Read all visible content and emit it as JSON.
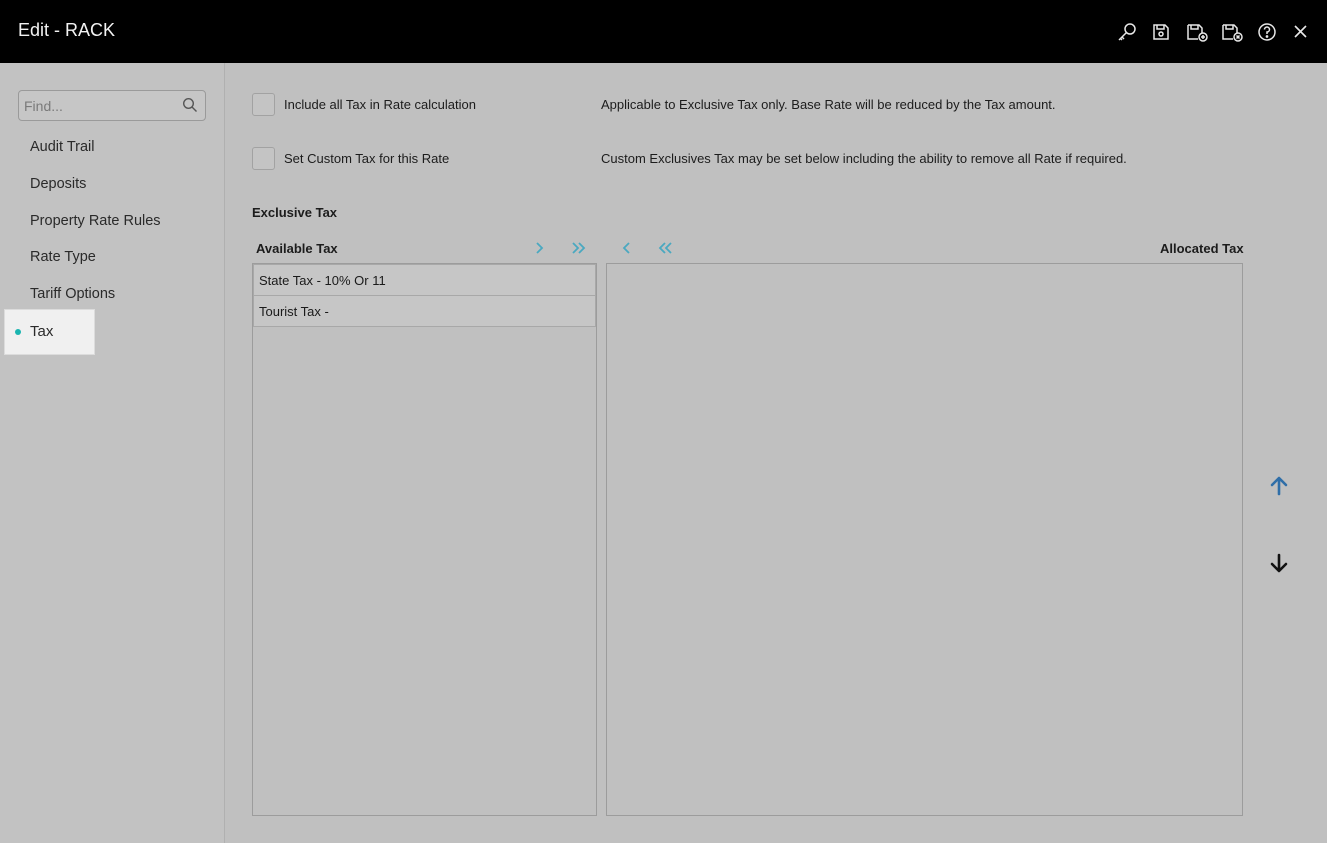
{
  "window": {
    "title": "Edit - RACK"
  },
  "toolbar": {
    "icons": [
      "key-icon",
      "save-icon",
      "save-new-icon",
      "save-close-icon",
      "help-icon",
      "close-icon"
    ]
  },
  "sidebar": {
    "search_placeholder": "Find...",
    "items": [
      {
        "label": "Audit Trail"
      },
      {
        "label": "Deposits"
      },
      {
        "label": "Property Rate Rules"
      },
      {
        "label": "Rate Type"
      },
      {
        "label": "Tariff Options"
      },
      {
        "label": "Tax",
        "active": true
      }
    ]
  },
  "main": {
    "options": [
      {
        "label": "Include all Tax in Rate calculation",
        "description": "Applicable to Exclusive Tax only. Base Rate will be reduced by the Tax amount.",
        "checked": false
      },
      {
        "label": "Set Custom Tax for this Rate",
        "description": "Custom Exclusives Tax may be set below including the ability to remove all Rate if required.",
        "checked": false
      }
    ],
    "section_title": "Exclusive Tax",
    "available_title": "Available Tax",
    "allocated_title": "Allocated Tax",
    "available_items": [
      "State Tax - 10% Or 11",
      "Tourist Tax -"
    ],
    "allocated_items": []
  },
  "colors": {
    "accent": "#1ab5b0",
    "arrow_teal": "#4aa8c0",
    "move_up": "#2f6ea8"
  }
}
